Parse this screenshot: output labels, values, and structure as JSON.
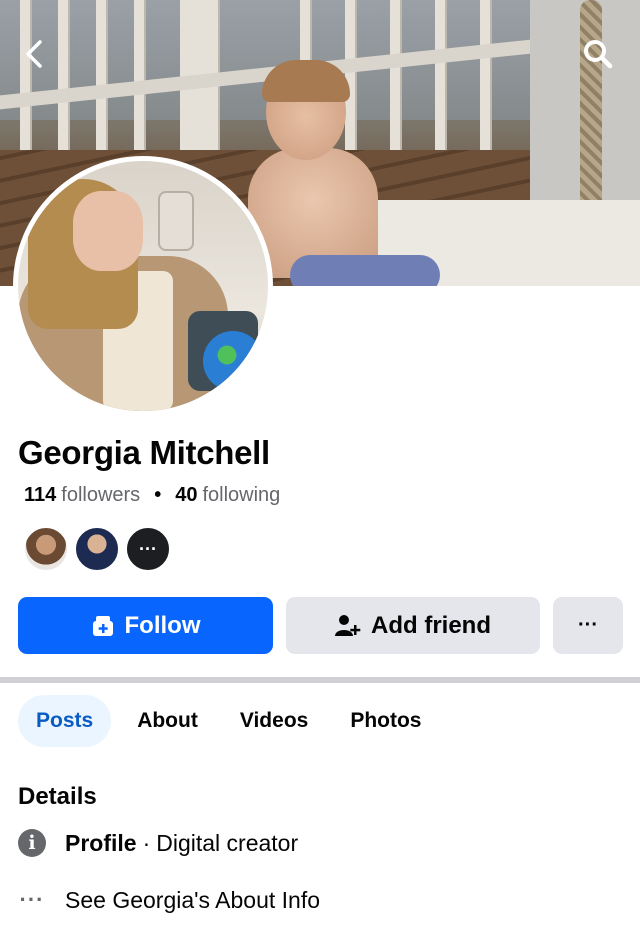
{
  "profile": {
    "name": "Georgia Mitchell",
    "followers_count": "114",
    "followers_label": "followers",
    "separator": "•",
    "following_count": "40",
    "following_label": "following",
    "mutual_more_label": "···"
  },
  "actions": {
    "follow_label": "Follow",
    "add_friend_label": "Add friend",
    "more_label": "···"
  },
  "tabs": [
    {
      "label": "Posts",
      "active": true
    },
    {
      "label": "About",
      "active": false
    },
    {
      "label": "Videos",
      "active": false
    },
    {
      "label": "Photos",
      "active": false
    }
  ],
  "details": {
    "title": "Details",
    "profile_key": "Profile",
    "profile_sep": "·",
    "profile_value": "Digital creator",
    "about_link": "See Georgia's About Info",
    "about_icon_label": "···"
  },
  "icons": {
    "back": "chevron-left-icon",
    "search": "search-icon",
    "follow": "follow-icon",
    "add_friend": "add-friend-icon",
    "info": "info-icon",
    "more": "more-dots-icon"
  },
  "colors": {
    "primary": "#0866ff",
    "secondary_button": "#e4e6eb",
    "active_tab_bg": "#ebf5ff",
    "active_tab_text": "#0a5cc2",
    "muted_text": "#65676b"
  }
}
